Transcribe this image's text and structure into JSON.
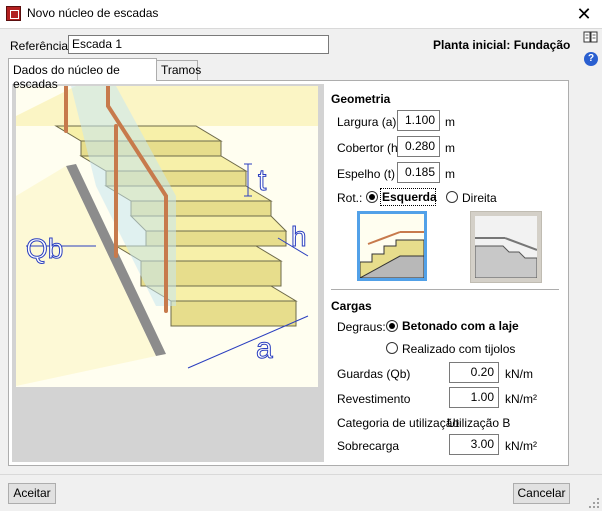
{
  "window": {
    "title": "Novo núcleo de escadas",
    "close_glyph": "✕"
  },
  "header": {
    "reference_label": "Referência",
    "reference_value": "Escada 1",
    "planta_label": "Planta inicial: Fundação"
  },
  "tabs": [
    {
      "label": "Dados do núcleo de escadas",
      "active": true
    },
    {
      "label": "Tramos",
      "active": false
    }
  ],
  "diagram_labels": {
    "t": "t",
    "h": "h",
    "qb": "Qb",
    "a": "a"
  },
  "geometria": {
    "title": "Geometria",
    "largura": {
      "label": "Largura (a)",
      "value": "1.100",
      "unit": "m"
    },
    "cobertor": {
      "label": "Cobertor (h)",
      "value": "0.280",
      "unit": "m"
    },
    "espelho": {
      "label": "Espelho (t)",
      "value": "0.185",
      "unit": "m"
    },
    "rot": {
      "label": "Rot.:",
      "options": [
        "Esquerda",
        "Direita"
      ],
      "selected": "Esquerda"
    }
  },
  "cargas": {
    "title": "Cargas",
    "degraus": {
      "label": "Degraus:",
      "options": [
        "Betonado com a laje",
        "Realizado com tijolos"
      ],
      "selected": "Betonado com a laje"
    },
    "guardas": {
      "label": "Guardas (Qb)",
      "value": "0.20",
      "unit": "kN/m"
    },
    "revestimento": {
      "label": "Revestimento",
      "value": "1.00",
      "unit": "kN/m²"
    },
    "categoria": {
      "label": "Categoria de utilização",
      "value": "Utilização B"
    },
    "sobrecarga": {
      "label": "Sobrecarga",
      "value": "3.00",
      "unit": "kN/m²"
    }
  },
  "footer": {
    "accept_label": "Aceitar",
    "cancel_label": "Cancelar"
  },
  "icons": [
    "app-icon",
    "close-icon",
    "book-icon",
    "help-icon"
  ],
  "colors": {
    "app_icon": "#b32020",
    "selected_thumb": "#52a1e8",
    "help": "#2a5fd0"
  }
}
